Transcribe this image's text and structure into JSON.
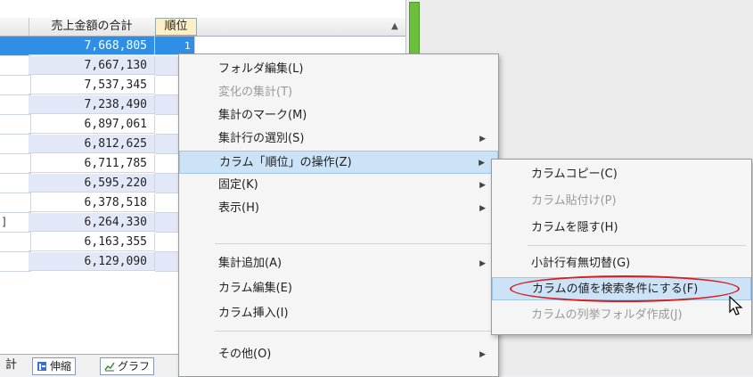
{
  "grid": {
    "headers": {
      "sales_total": "売上金額の合計",
      "rank": "順位"
    },
    "rows": [
      {
        "label": "",
        "value": "7,668,805",
        "rank": "1"
      },
      {
        "label": "",
        "value": "7,667,130",
        "rank": ""
      },
      {
        "label": "",
        "value": "7,537,345",
        "rank": ""
      },
      {
        "label": "",
        "value": "7,238,490",
        "rank": ""
      },
      {
        "label": "",
        "value": "6,897,061",
        "rank": ""
      },
      {
        "label": "",
        "value": "6,812,625",
        "rank": ""
      },
      {
        "label": "",
        "value": "6,711,785",
        "rank": ""
      },
      {
        "label": "",
        "value": "6,595,220",
        "rank": ""
      },
      {
        "label": "",
        "value": "6,378,518",
        "rank": ""
      },
      {
        "label": "]",
        "value": "6,264,330",
        "rank": ""
      },
      {
        "label": "",
        "value": "6,163,355",
        "rank": ""
      },
      {
        "label": "",
        "value": "6,129,090",
        "rank": ""
      }
    ]
  },
  "tabbar": {
    "lead_text": "計",
    "tab_stretch": "伸縮",
    "tab_graph": "グラフ"
  },
  "context_menu": {
    "items": [
      {
        "label": "フォルダ編集(L)",
        "disabled": false
      },
      {
        "label": "変化の集計(T)",
        "disabled": true
      },
      {
        "label": "集計のマーク(M)",
        "disabled": false
      },
      {
        "label": "集計行の選別(S)",
        "disabled": false,
        "submenu": true
      },
      {
        "label": "カラム「順位」の操作(Z)",
        "disabled": false,
        "submenu": true,
        "highlighted": true
      },
      {
        "label": "固定(K)",
        "disabled": false,
        "submenu": true
      },
      {
        "label": "表示(H)",
        "disabled": false,
        "submenu": true
      },
      {
        "label": "集計追加(A)",
        "disabled": false,
        "submenu": true
      },
      {
        "label": "カラム編集(E)",
        "disabled": false
      },
      {
        "label": "カラム挿入(I)",
        "disabled": false
      },
      {
        "label": "その他(O)",
        "disabled": false,
        "submenu": true
      }
    ]
  },
  "submenu": {
    "items": [
      {
        "label": "カラムコピー(C)",
        "disabled": false
      },
      {
        "label": "カラム貼付け(P)",
        "disabled": true
      },
      {
        "label": "カラムを隠す(H)",
        "disabled": false
      },
      {
        "label": "小計行有無切替(G)",
        "disabled": false
      },
      {
        "label": "カラムの値を検索条件にする(F)",
        "disabled": false,
        "highlighted": true
      },
      {
        "label": "カラムの列挙フォルダ作成(J)",
        "disabled": true
      }
    ]
  },
  "colors": {
    "selection": "#2f8fe6",
    "highlight": "#cce3f7",
    "annotation": "#d81e1e",
    "alt_row": "#e3e8f8"
  }
}
